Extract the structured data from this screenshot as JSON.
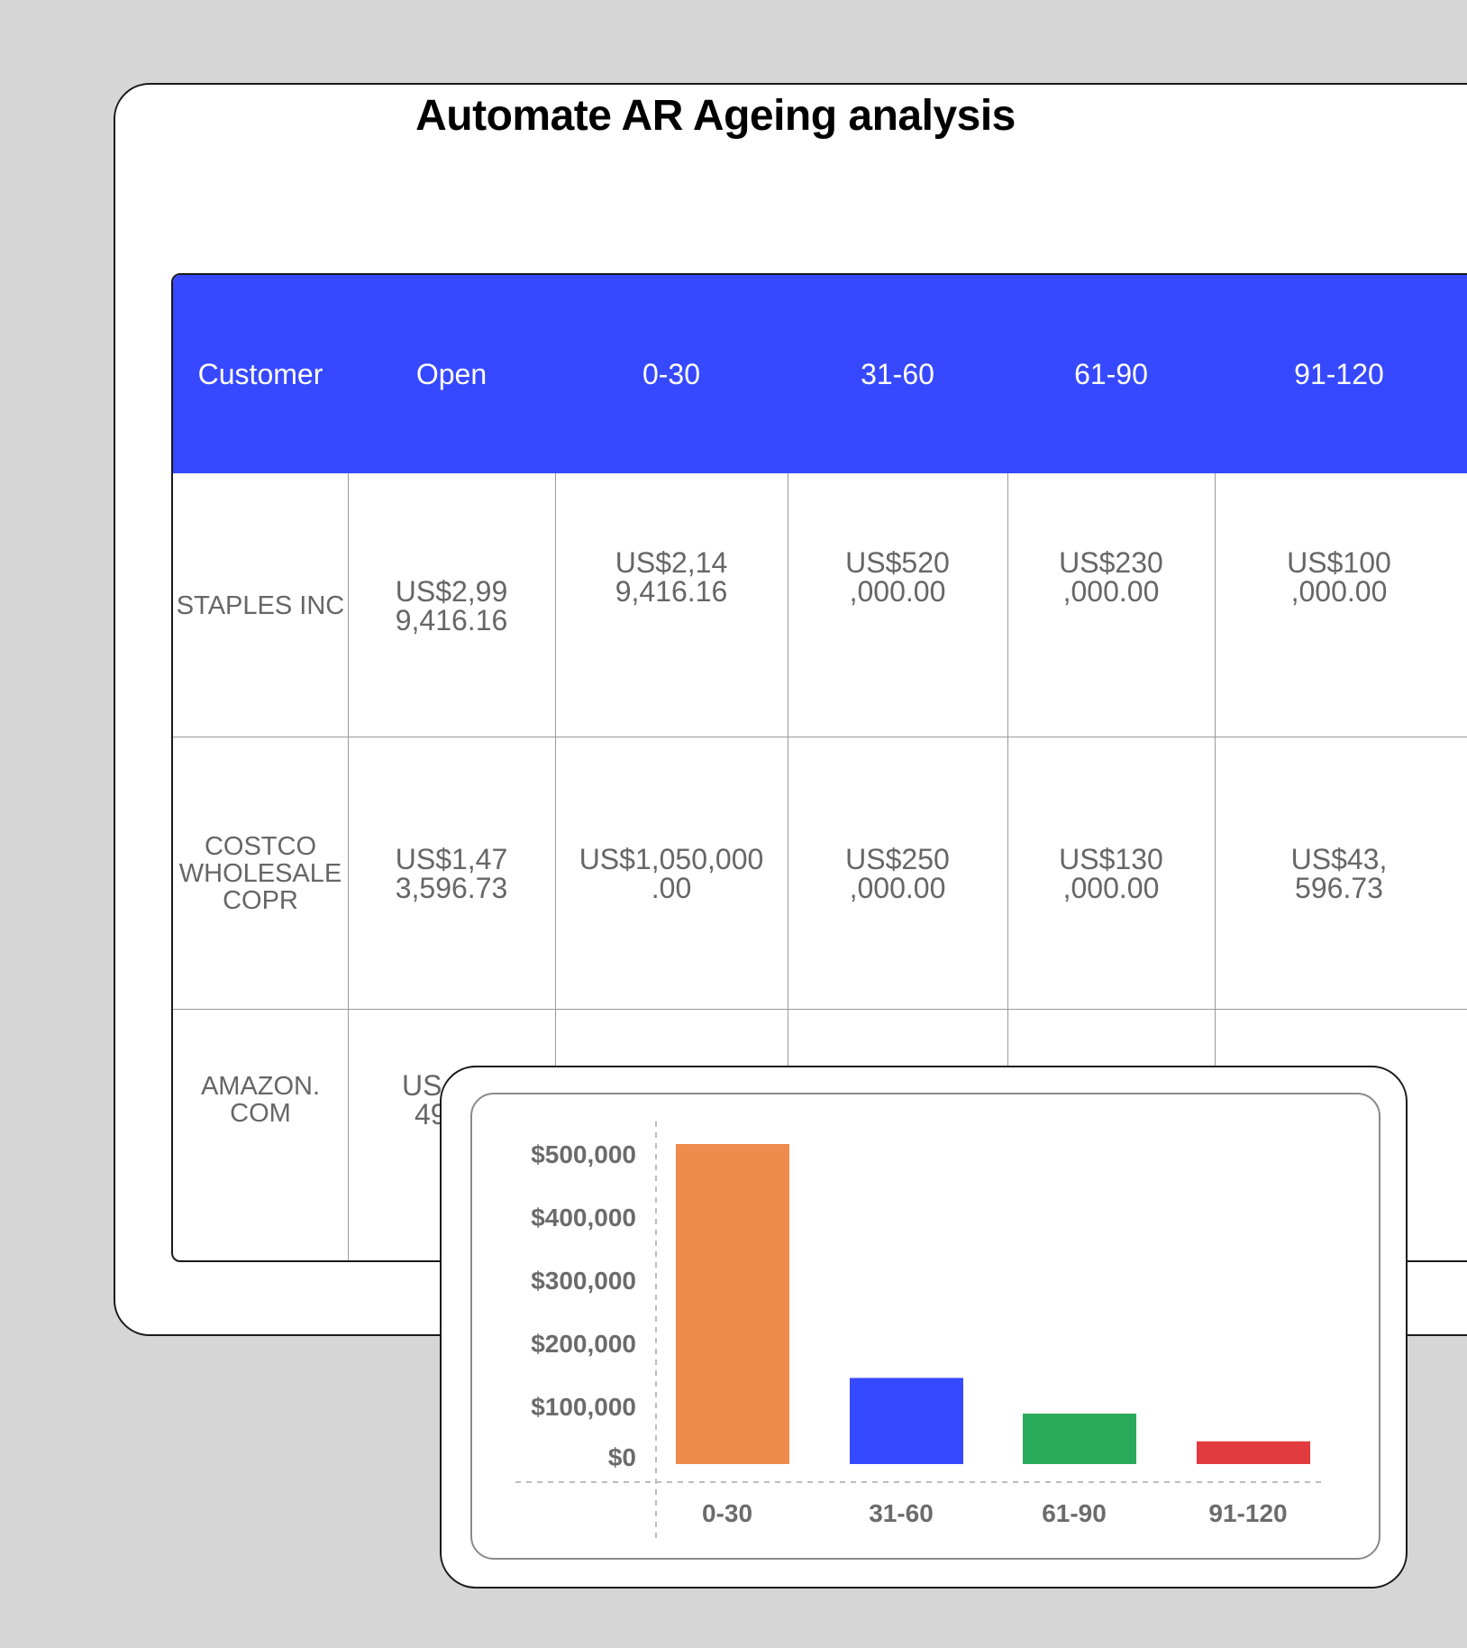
{
  "page": {
    "title": "Automate AR Ageing analysis"
  },
  "table": {
    "headers": [
      "Customer",
      "Open",
      "0-30",
      "31-60",
      "61-90",
      "91-120"
    ],
    "rows": [
      {
        "customer": [
          "STAPLES INC"
        ],
        "cells": [
          [
            "US$2,99",
            "9,416.16"
          ],
          [
            "US$2,14",
            "9,416.16"
          ],
          [
            "US$520",
            ",000.00"
          ],
          [
            "US$230",
            ",000.00"
          ],
          [
            "US$100",
            ",000.00"
          ]
        ]
      },
      {
        "customer": [
          "COSTCO",
          "WHOLESALE",
          "COPR"
        ],
        "cells": [
          [
            "US$1,47",
            "3,596.73"
          ],
          [
            "US$1,050,000",
            ".00"
          ],
          [
            "US$250",
            ",000.00"
          ],
          [
            "US$130",
            ",000.00"
          ],
          [
            "US$43,",
            "596.73"
          ]
        ]
      },
      {
        "customer": [
          "AMAZON.",
          "COM"
        ],
        "cells": [
          [
            "US",
            "49"
          ],
          [],
          [],
          [],
          []
        ]
      }
    ]
  },
  "chart_data": {
    "type": "bar",
    "categories": [
      "0-30",
      "31-60",
      "61-90",
      "91-120"
    ],
    "values": [
      520000,
      140000,
      82000,
      37000
    ],
    "colors": [
      "#ee8c4e",
      "#3549ff",
      "#2aab5b",
      "#e23b3f"
    ],
    "yticks": [
      "$0",
      "$100,000",
      "$200,000",
      "$300,000",
      "$400,000",
      "$500,000"
    ],
    "ylim": [
      0,
      520000
    ],
    "grid": false
  }
}
